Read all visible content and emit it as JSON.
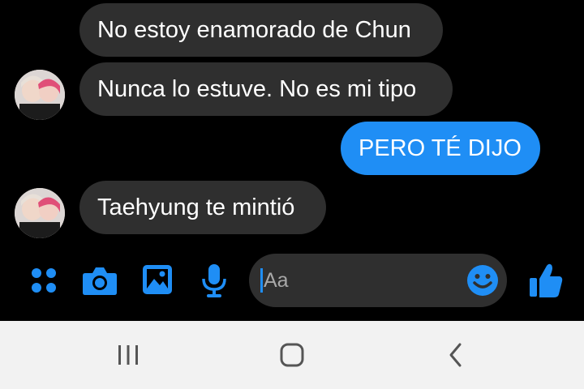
{
  "messages": [
    {
      "side": "received",
      "text": "No estoy enamorado de Chun"
    },
    {
      "side": "received",
      "text": "Nunca lo estuve. No es mi tipo"
    },
    {
      "side": "sent",
      "text": "PERO TÉ DIJO"
    },
    {
      "side": "received",
      "text": "Taehyung te mintió"
    }
  ],
  "composer": {
    "placeholder": "Aa",
    "icons": [
      "grid-icon",
      "camera-icon",
      "image-icon",
      "microphone-icon",
      "emoji-icon",
      "thumbs-up-icon"
    ]
  },
  "navigation": {
    "icons": [
      "recent-apps-icon",
      "home-icon",
      "back-icon"
    ]
  },
  "colors": {
    "accent": "#1f8ef5",
    "received_bubble": "#2f2f2f",
    "background": "#000000",
    "nav_bar": "#f2f2f2"
  }
}
